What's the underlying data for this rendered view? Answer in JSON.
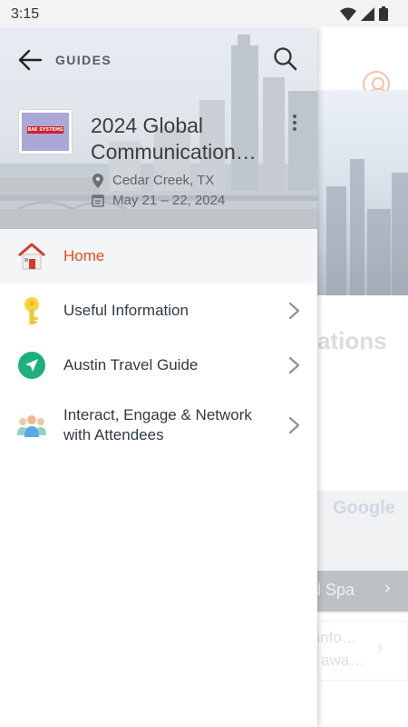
{
  "status_bar": {
    "time": "3:15"
  },
  "drawer": {
    "section_label": "GUIDES",
    "event": {
      "title_line1": "2024 Global",
      "title_line2": "Communication…",
      "location": "Cedar Creek, TX",
      "dates": "May 21 – 22, 2024",
      "logo_text": "BAE SYSTEMS"
    },
    "nav_items": [
      {
        "label": "Home",
        "icon": "home-icon",
        "active": true
      },
      {
        "label": "Useful Information",
        "icon": "key-icon",
        "active": false
      },
      {
        "label": "Austin Travel Guide",
        "icon": "navigation-arrow-icon",
        "active": false
      },
      {
        "label_line1": "Interact, Engage & Network",
        "label_line2": "with Attendees",
        "icon": "people-icon",
        "active": false
      }
    ]
  },
  "background": {
    "section_title": "ations",
    "map_watermark": "Google",
    "map_caption": "d Spa",
    "info_line1": "t info…",
    "info_line2": "e awa…"
  },
  "colors": {
    "accent": "#ea4a16",
    "text": "#2f3a45",
    "chevron": "#8a939c",
    "key_yellow": "#f7d53a",
    "nav_green": "#1fb07a"
  }
}
